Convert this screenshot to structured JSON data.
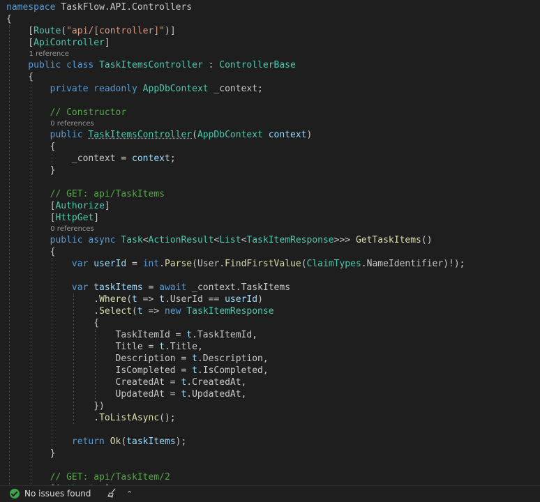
{
  "editor": {
    "lines": [
      {
        "tokens": [
          [
            "k",
            "namespace"
          ],
          [
            "n",
            " TaskFlow.API.Controllers"
          ]
        ]
      },
      {
        "tokens": [
          [
            "n",
            "{"
          ]
        ]
      },
      {
        "tokens": [
          [
            "n",
            "    ["
          ],
          [
            "t",
            "Route"
          ],
          [
            "n",
            "("
          ],
          [
            "s",
            "\"api/[controller]\""
          ],
          [
            "n",
            ")]"
          ]
        ]
      },
      {
        "tokens": [
          [
            "n",
            "    ["
          ],
          [
            "t",
            "ApiController"
          ],
          [
            "n",
            "]"
          ]
        ]
      },
      {
        "tokens": [
          [
            "k",
            "    public class "
          ],
          [
            "t",
            "TaskItemsController"
          ],
          [
            "n",
            " : "
          ],
          [
            "t",
            "ControllerBase"
          ]
        ]
      },
      {
        "tokens": [
          [
            "n",
            "    {"
          ]
        ]
      },
      {
        "tokens": [
          [
            "k",
            "        private readonly "
          ],
          [
            "t",
            "AppDbContext"
          ],
          [
            "n",
            " _context;"
          ]
        ]
      },
      {
        "tokens": []
      },
      {
        "tokens": [
          [
            "c",
            "        // Constructor"
          ]
        ]
      },
      {
        "tokens": [
          [
            "k",
            "        public "
          ],
          [
            "ts",
            "TaskItemsController"
          ],
          [
            "n",
            "("
          ],
          [
            "t",
            "AppDbContext"
          ],
          [
            "p",
            " context"
          ],
          [
            "n",
            ")"
          ]
        ]
      },
      {
        "tokens": [
          [
            "n",
            "        {"
          ]
        ]
      },
      {
        "tokens": [
          [
            "n",
            "            _context = "
          ],
          [
            "p",
            "context"
          ],
          [
            "n",
            ";"
          ]
        ]
      },
      {
        "tokens": [
          [
            "n",
            "        }"
          ]
        ]
      },
      {
        "tokens": []
      },
      {
        "tokens": [
          [
            "c",
            "        // GET: api/TaskItems"
          ]
        ]
      },
      {
        "tokens": [
          [
            "n",
            "        ["
          ],
          [
            "t",
            "Authorize"
          ],
          [
            "n",
            "]"
          ]
        ]
      },
      {
        "tokens": [
          [
            "n",
            "        ["
          ],
          [
            "t",
            "HttpGet"
          ],
          [
            "n",
            "]"
          ]
        ]
      },
      {
        "tokens": [
          [
            "k",
            "        public async "
          ],
          [
            "t",
            "Task"
          ],
          [
            "n",
            "<"
          ],
          [
            "t",
            "ActionResult"
          ],
          [
            "n",
            "<"
          ],
          [
            "t",
            "List"
          ],
          [
            "n",
            "<"
          ],
          [
            "t",
            "TaskItemResponse"
          ],
          [
            "n",
            ">>> "
          ],
          [
            "m",
            "GetTaskItems"
          ],
          [
            "n",
            "()"
          ]
        ]
      },
      {
        "tokens": [
          [
            "n",
            "        {"
          ]
        ]
      },
      {
        "tokens": [
          [
            "k",
            "            var "
          ],
          [
            "p",
            "userId"
          ],
          [
            "n",
            " = "
          ],
          [
            "k",
            "int"
          ],
          [
            "n",
            "."
          ],
          [
            "m",
            "Parse"
          ],
          [
            "n",
            "(User."
          ],
          [
            "m",
            "FindFirstValue"
          ],
          [
            "n",
            "("
          ],
          [
            "t",
            "ClaimTypes"
          ],
          [
            "n",
            ".NameIdentifier)!);"
          ]
        ]
      },
      {
        "tokens": []
      },
      {
        "tokens": [
          [
            "k",
            "            var "
          ],
          [
            "p",
            "taskItems"
          ],
          [
            "n",
            " = "
          ],
          [
            "k",
            "await"
          ],
          [
            "n",
            " _context.TaskItems"
          ]
        ]
      },
      {
        "tokens": [
          [
            "n",
            "                ."
          ],
          [
            "m",
            "Where"
          ],
          [
            "n",
            "("
          ],
          [
            "p",
            "t"
          ],
          [
            "n",
            " => "
          ],
          [
            "p",
            "t"
          ],
          [
            "n",
            ".UserId == "
          ],
          [
            "p",
            "userId"
          ],
          [
            "n",
            ")"
          ]
        ]
      },
      {
        "tokens": [
          [
            "n",
            "                ."
          ],
          [
            "m",
            "Select"
          ],
          [
            "n",
            "("
          ],
          [
            "p",
            "t"
          ],
          [
            "n",
            " => "
          ],
          [
            "k",
            "new "
          ],
          [
            "t",
            "TaskItemResponse"
          ]
        ]
      },
      {
        "tokens": [
          [
            "n",
            "                {"
          ]
        ]
      },
      {
        "tokens": [
          [
            "n",
            "                    TaskItemId = "
          ],
          [
            "p",
            "t"
          ],
          [
            "n",
            ".TaskItemId,"
          ]
        ]
      },
      {
        "tokens": [
          [
            "n",
            "                    Title = "
          ],
          [
            "p",
            "t"
          ],
          [
            "n",
            ".Title,"
          ]
        ]
      },
      {
        "tokens": [
          [
            "n",
            "                    Description = "
          ],
          [
            "p",
            "t"
          ],
          [
            "n",
            ".Description,"
          ]
        ]
      },
      {
        "tokens": [
          [
            "n",
            "                    IsCompleted = "
          ],
          [
            "p",
            "t"
          ],
          [
            "n",
            ".IsCompleted,"
          ]
        ]
      },
      {
        "tokens": [
          [
            "n",
            "                    CreatedAt = "
          ],
          [
            "p",
            "t"
          ],
          [
            "n",
            ".CreatedAt,"
          ]
        ]
      },
      {
        "tokens": [
          [
            "n",
            "                    UpdatedAt = "
          ],
          [
            "p",
            "t"
          ],
          [
            "n",
            ".UpdatedAt,"
          ]
        ]
      },
      {
        "tokens": [
          [
            "n",
            "                })"
          ]
        ]
      },
      {
        "tokens": [
          [
            "n",
            "                ."
          ],
          [
            "m",
            "ToListAsync"
          ],
          [
            "n",
            "();"
          ]
        ]
      },
      {
        "tokens": []
      },
      {
        "tokens": [
          [
            "k",
            "            return "
          ],
          [
            "m",
            "Ok"
          ],
          [
            "n",
            "("
          ],
          [
            "p",
            "taskItems"
          ],
          [
            "n",
            ");"
          ]
        ]
      },
      {
        "tokens": [
          [
            "n",
            "        }"
          ]
        ]
      },
      {
        "tokens": []
      },
      {
        "tokens": [
          [
            "c",
            "        // GET: api/TaskItem/2"
          ]
        ]
      },
      {
        "tokens": [
          [
            "n",
            "        ["
          ],
          [
            "t",
            "Authorize"
          ],
          [
            "n",
            "]"
          ]
        ]
      }
    ],
    "references": [
      {
        "after_line": 3,
        "indent": 4,
        "text": "1 reference"
      },
      {
        "after_line": 8,
        "indent": 8,
        "text": "0 references"
      },
      {
        "after_line": 16,
        "indent": 8,
        "text": "0 references"
      }
    ]
  },
  "statusbar": {
    "issues_text": "No issues found",
    "cleanup_icon": "broom-icon",
    "status_icon": "check-circle-icon",
    "chevron_icon": "chevron-up-icon"
  }
}
